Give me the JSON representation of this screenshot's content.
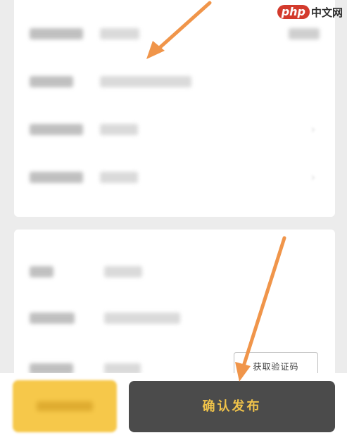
{
  "watermark": {
    "logo": "php",
    "text": "中文网"
  },
  "form": {
    "verify_code_button": "获取验证码"
  },
  "footer": {
    "confirm_button": "确认发布"
  },
  "colors": {
    "accent_yellow": "#f6c84a",
    "dark_button": "#4b4b4b",
    "confirm_text": "#f0c34a",
    "annotation_arrow": "#f0954a"
  }
}
